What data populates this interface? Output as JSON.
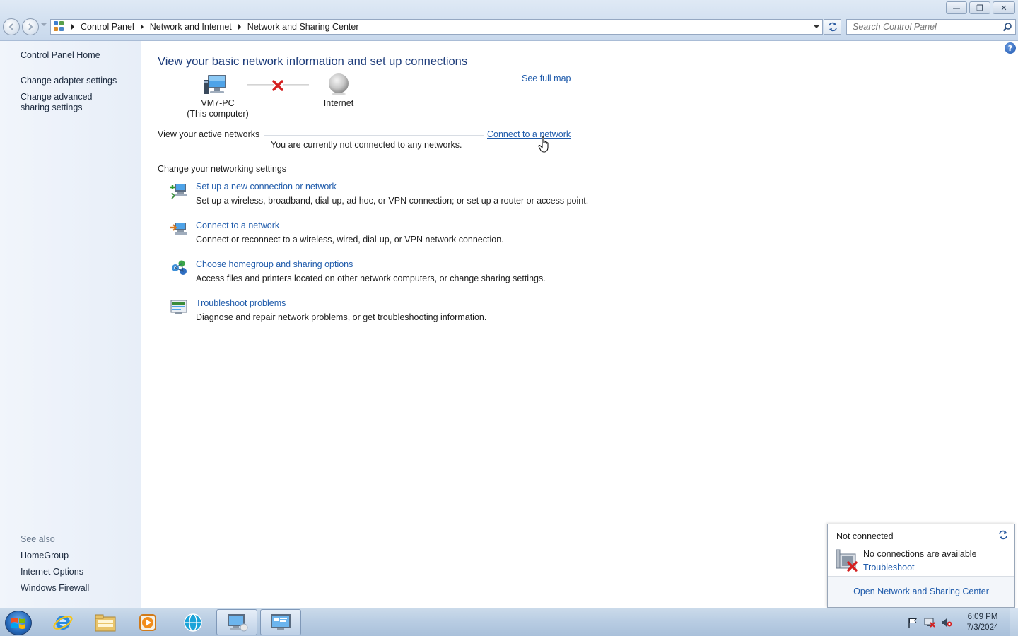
{
  "window": {
    "minimize_glyph": "—",
    "restore_glyph": "❐",
    "close_glyph": "✕"
  },
  "address": {
    "breadcrumbs": [
      "Control Panel",
      "Network and Internet",
      "Network and Sharing Center"
    ],
    "search_placeholder": "Search Control Panel"
  },
  "sidebar": {
    "home": "Control Panel Home",
    "items": [
      "Change adapter settings",
      "Change advanced sharing settings"
    ],
    "see_also_title": "See also",
    "see_also": [
      "HomeGroup",
      "Internet Options",
      "Windows Firewall"
    ]
  },
  "main": {
    "title": "View your basic network information and set up connections",
    "see_full_map": "See full map",
    "map": {
      "computer_name": "VM7-PC",
      "computer_sub": "(This computer)",
      "internet": "Internet"
    },
    "active_networks": {
      "title": "View your active networks",
      "connect_link": "Connect to a network",
      "status": "You are currently not connected to any networks."
    },
    "settings": {
      "title": "Change your networking settings",
      "tasks": [
        {
          "link": "Set up a new connection or network",
          "desc": "Set up a wireless, broadband, dial-up, ad hoc, or VPN connection; or set up a router or access point.",
          "icon": "new-connection-icon"
        },
        {
          "link": "Connect to a network",
          "desc": "Connect or reconnect to a wireless, wired, dial-up, or VPN network connection.",
          "icon": "connect-network-icon"
        },
        {
          "link": "Choose homegroup and sharing options",
          "desc": "Access files and printers located on other network computers, or change sharing settings.",
          "icon": "homegroup-icon"
        },
        {
          "link": "Troubleshoot problems",
          "desc": "Diagnose and repair network problems, or get troubleshooting information.",
          "icon": "troubleshoot-icon"
        }
      ]
    }
  },
  "flyout": {
    "title": "Not connected",
    "no_connections": "No connections are available",
    "troubleshoot": "Troubleshoot",
    "open_center": "Open Network and Sharing Center"
  },
  "taskbar": {
    "time": "6:09 PM",
    "date": "7/3/2024"
  },
  "colors": {
    "link": "#1f5bab",
    "title": "#1d3c7a",
    "sidebar_bg": "#e7eef8"
  }
}
